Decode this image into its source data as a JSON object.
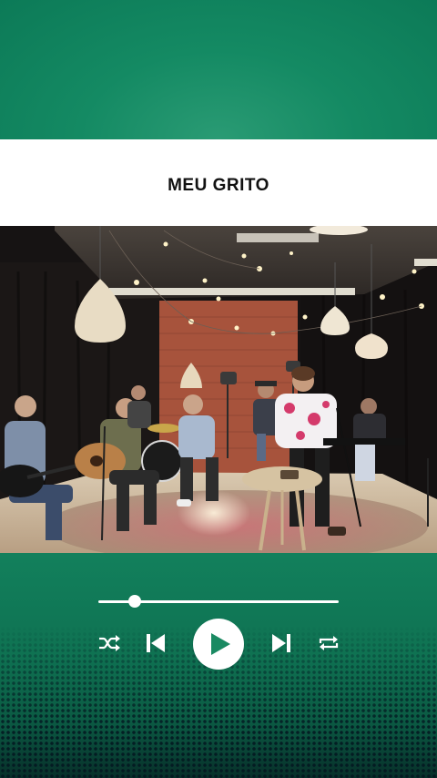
{
  "song": {
    "title": "MEU GRITO"
  },
  "player": {
    "progress_fraction": 0.15,
    "controls": {
      "shuffle_icon": "shuffle-icon",
      "previous_icon": "skip-previous-icon",
      "play_icon": "play-icon",
      "next_icon": "skip-next-icon",
      "repeat_icon": "repeat-icon"
    }
  },
  "colors": {
    "background_green": "#0f6f54",
    "title_card": "#ffffff",
    "controls": "#ffffff",
    "play_glyph": "#1a8a62"
  }
}
